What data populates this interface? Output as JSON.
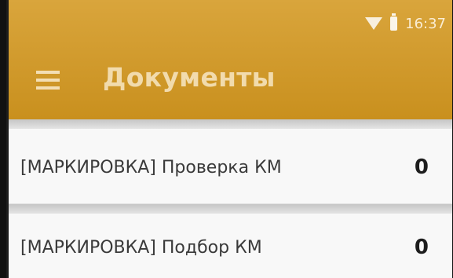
{
  "status": {
    "time": "16:37"
  },
  "header": {
    "title": "Документы"
  },
  "documents": [
    {
      "label": "[МАРКИРОВКА] Проверка КМ",
      "count": "0"
    },
    {
      "label": "[МАРКИРОВКА] Подбор КМ",
      "count": "0"
    }
  ],
  "icons": {
    "menu": "hamburger-menu-icon",
    "wifi": "wifi-icon",
    "battery": "battery-icon"
  },
  "colors": {
    "app_bar": "#c9901e",
    "background": "#ececec",
    "text": "#3a3a3a"
  }
}
